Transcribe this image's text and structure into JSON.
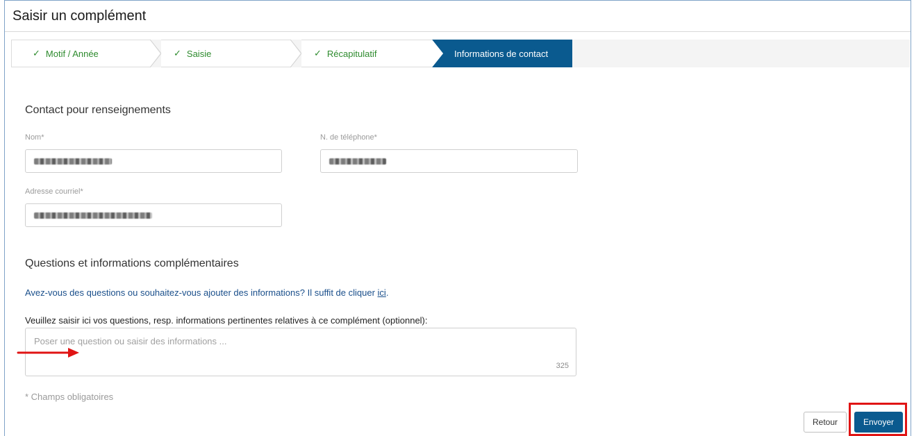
{
  "page": {
    "title": "Saisir un complément"
  },
  "steps": [
    {
      "label": "Motif / Année",
      "check": "✓",
      "state": "done"
    },
    {
      "label": "Saisie",
      "check": "✓",
      "state": "done"
    },
    {
      "label": "Récapitulatif",
      "check": "✓",
      "state": "done"
    },
    {
      "label": "Informations de contact",
      "check": "",
      "state": "active"
    }
  ],
  "contact": {
    "section_title": "Contact pour renseignements",
    "name_label": "Nom*",
    "phone_label": "N. de téléphone*",
    "email_label": "Adresse courriel*"
  },
  "questions": {
    "section_title": "Questions et informations complémentaires",
    "info_text": "Avez-vous des questions ou souhaitez-vous ajouter des informations? Il suffit de cliquer ",
    "info_link": "ici",
    "info_end": ".",
    "field_label": "Veuillez saisir ici vos questions, resp. informations pertinentes relatives à ce complément (optionnel):",
    "placeholder": "Poser une question ou saisir des informations ...",
    "char_count": "325"
  },
  "footer": {
    "required_note": "* Champs obligatoires",
    "back_label": "Retour",
    "send_label": "Envoyer"
  },
  "colors": {
    "accent": "#0a5a8f",
    "done_step": "#2e8b2e",
    "link": "#1a4f8b",
    "highlight": "#e01414"
  }
}
